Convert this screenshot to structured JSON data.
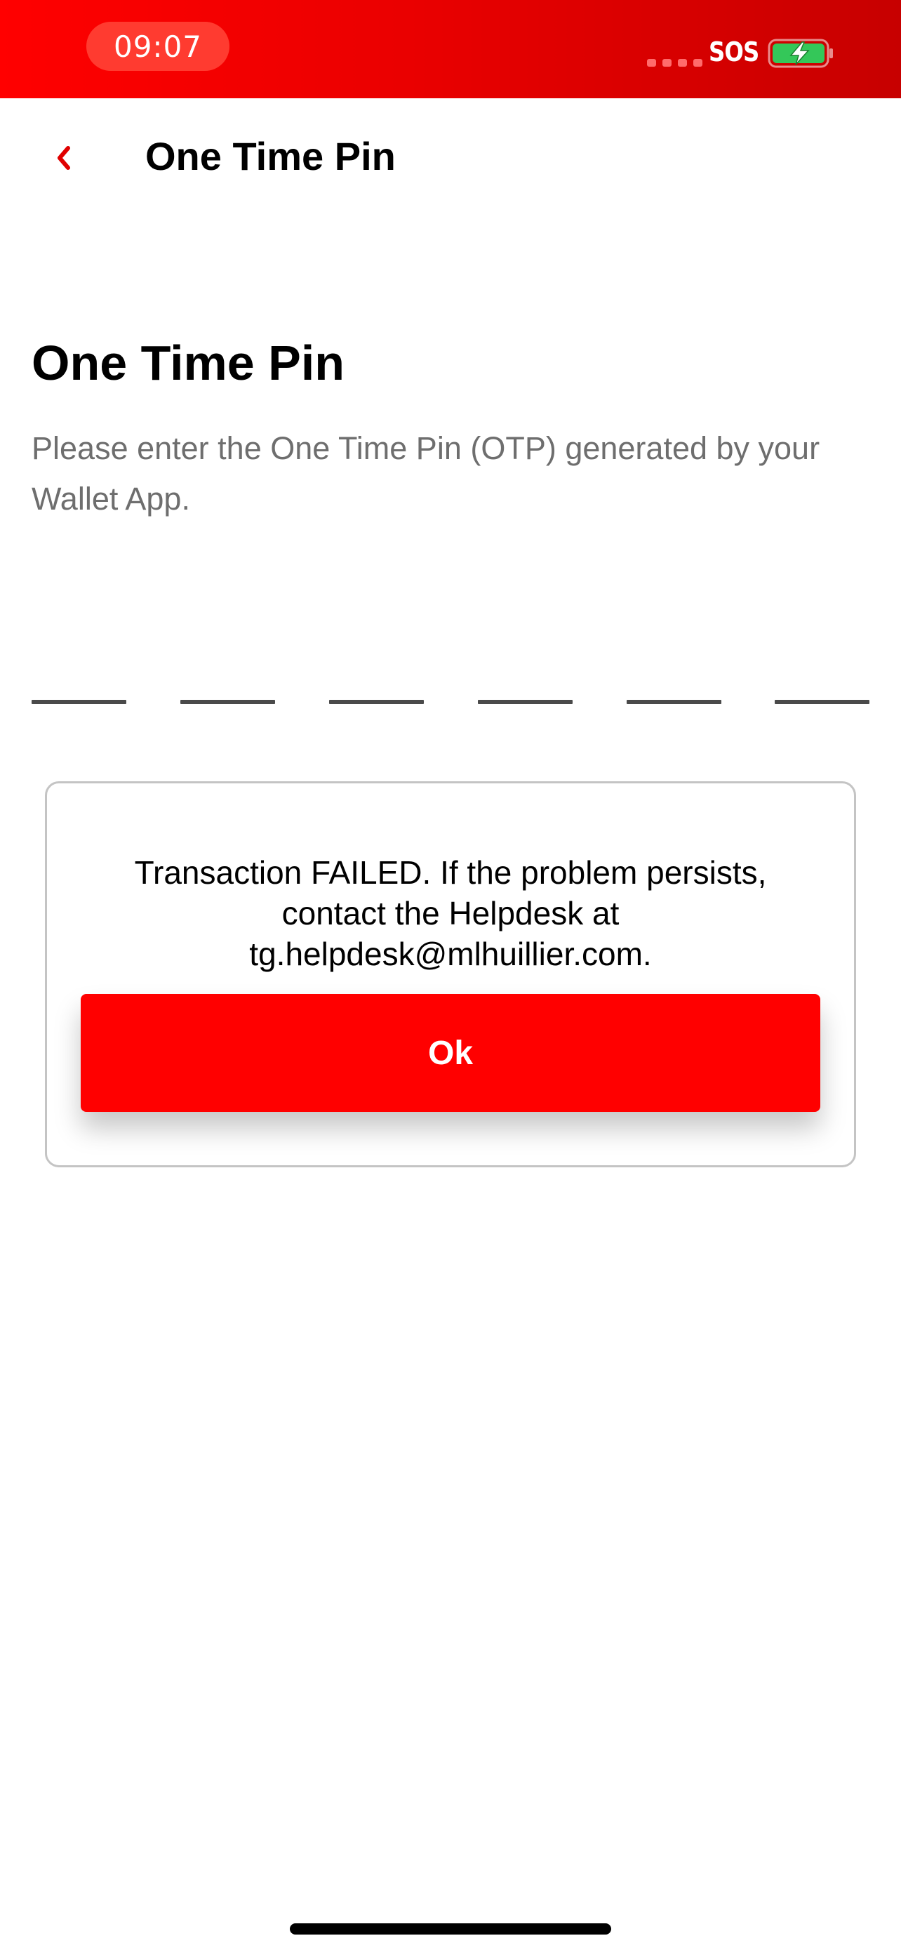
{
  "status_bar": {
    "time": "09:07",
    "carrier_text": "SOS",
    "battery_icon": "battery-charging-icon",
    "colors": {
      "background_start": "#ff0000",
      "background_end": "#c70000",
      "time_pill": "#ff3b30",
      "battery_fill": "#34c759"
    }
  },
  "nav": {
    "back_icon": "chevron-left-icon",
    "title": "One Time Pin",
    "accent_color": "#e00000"
  },
  "content": {
    "heading": "One Time Pin",
    "instructions": "Please enter the One Time Pin (OTP) generated by your Wallet App.",
    "otp_length": 6
  },
  "dialog": {
    "message_line_1": "Transaction FAILED. If the problem persists,",
    "message_line_2": "contact the Helpdesk at",
    "message_line_3": "tg.helpdesk@mlhuillier.com.",
    "ok_label": "Ok",
    "button_color": "#ff0000"
  }
}
